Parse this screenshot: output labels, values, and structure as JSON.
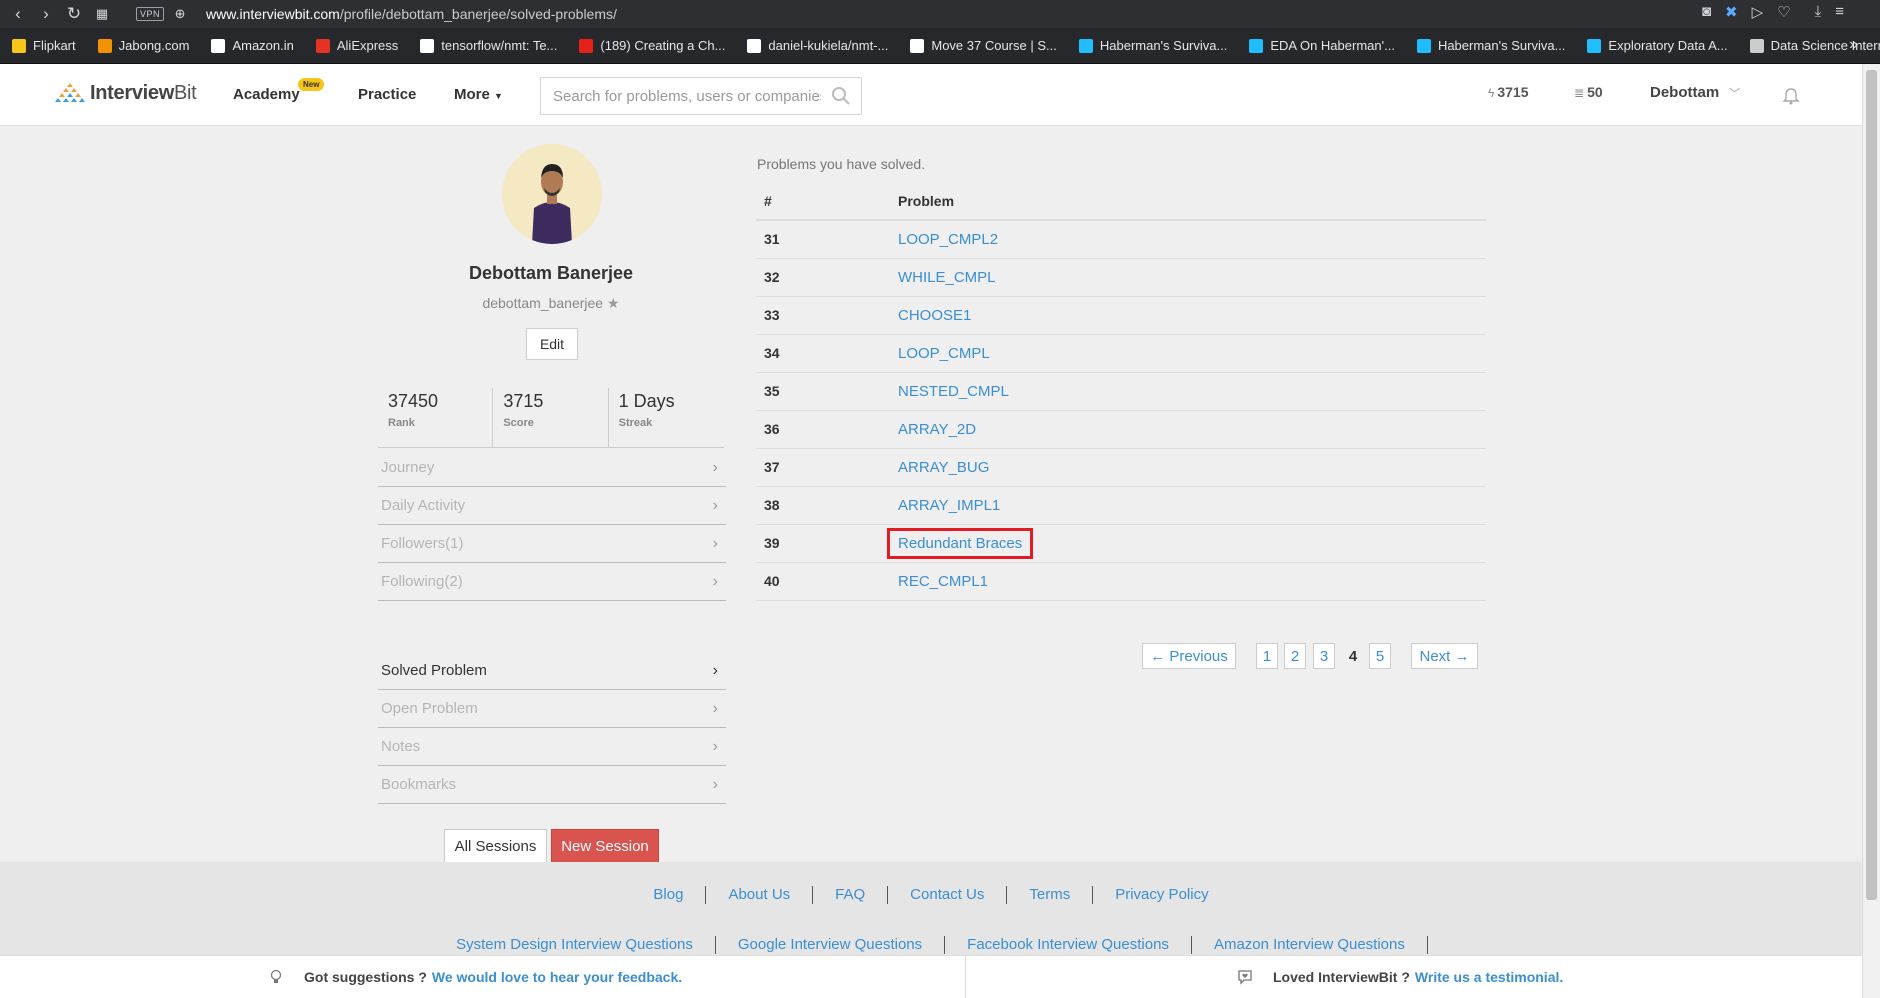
{
  "browser": {
    "url_host": "www.interviewbit.com",
    "url_path": "/profile/debottam_banerjee/solved-problems/",
    "vpn_label": "VPN",
    "bookmarks": [
      {
        "label": "Flipkart",
        "color": "#f7c61a"
      },
      {
        "label": "Jabong.com",
        "color": "#f39200"
      },
      {
        "label": "Amazon.in",
        "color": "#ffffff"
      },
      {
        "label": "AliExpress",
        "color": "#e43225"
      },
      {
        "label": "tensorflow/nmt: Te...",
        "color": "#ffffff"
      },
      {
        "label": "(189) Creating a Ch...",
        "color": "#e62117"
      },
      {
        "label": "daniel-kukiela/nmt-...",
        "color": "#ffffff"
      },
      {
        "label": "Move 37 Course | S...",
        "color": "#ffffff"
      },
      {
        "label": "Haberman's Surviva...",
        "color": "#20beff"
      },
      {
        "label": "EDA On Haberman'...",
        "color": "#20beff"
      },
      {
        "label": "Haberman's Surviva...",
        "color": "#20beff"
      },
      {
        "label": "Exploratory Data A...",
        "color": "#20beff"
      },
      {
        "label": "Data Science Intern...",
        "color": "#cccccc"
      }
    ]
  },
  "header": {
    "logo_text_bold": "Interview",
    "logo_text_light": "Bit",
    "nav_academy": "Academy",
    "badge_new": "New",
    "nav_practice": "Practice",
    "nav_more": "More",
    "search_placeholder": "Search for problems, users or companies",
    "stat_score": "3715",
    "stat_coins": "50",
    "user_name": "Debottam"
  },
  "profile": {
    "name": "Debottam Banerjee",
    "handle": "debottam_banerjee",
    "edit_label": "Edit",
    "stats": [
      {
        "value": "37450",
        "label": "Rank"
      },
      {
        "value": "3715",
        "label": "Score"
      },
      {
        "value": "1 Days",
        "label": "Streak"
      }
    ],
    "menu_top": [
      {
        "label": "Journey"
      },
      {
        "label": "Daily Activity"
      },
      {
        "label": "Followers(1)"
      },
      {
        "label": "Following(2)"
      }
    ],
    "menu_bottom": [
      {
        "label": "Solved Problem"
      },
      {
        "label": "Open Problem"
      },
      {
        "label": "Notes"
      },
      {
        "label": "Bookmarks"
      }
    ],
    "all_sessions_label": "All Sessions",
    "new_session_label": "New Session"
  },
  "problems": {
    "caption": "Problems you have solved.",
    "col_num": "#",
    "col_problem": "Problem",
    "rows": [
      {
        "num": "31",
        "name": "LOOP_CMPL2"
      },
      {
        "num": "32",
        "name": "WHILE_CMPL"
      },
      {
        "num": "33",
        "name": "CHOOSE1"
      },
      {
        "num": "34",
        "name": "LOOP_CMPL"
      },
      {
        "num": "35",
        "name": "NESTED_CMPL"
      },
      {
        "num": "36",
        "name": "ARRAY_2D"
      },
      {
        "num": "37",
        "name": "ARRAY_BUG"
      },
      {
        "num": "38",
        "name": "ARRAY_IMPL1"
      },
      {
        "num": "39",
        "name": "Redundant Braces"
      },
      {
        "num": "40",
        "name": "REC_CMPL1"
      }
    ],
    "pagination": {
      "prev": "← Previous",
      "pages": [
        "1",
        "2",
        "3",
        "4",
        "5"
      ],
      "current": "4",
      "next": "Next →"
    }
  },
  "footer": {
    "links_row1": [
      "Blog",
      "About Us",
      "FAQ",
      "Contact Us",
      "Terms",
      "Privacy Policy"
    ],
    "links_row2": [
      "System Design Interview Questions",
      "Google Interview Questions",
      "Facebook Interview Questions",
      "Amazon Interview Questions"
    ],
    "suggest_text": "Got suggestions ?",
    "suggest_link": "We would love to hear your feedback.",
    "loved_text": "Loved InterviewBit ?",
    "loved_link": "Write us a testimonial."
  }
}
